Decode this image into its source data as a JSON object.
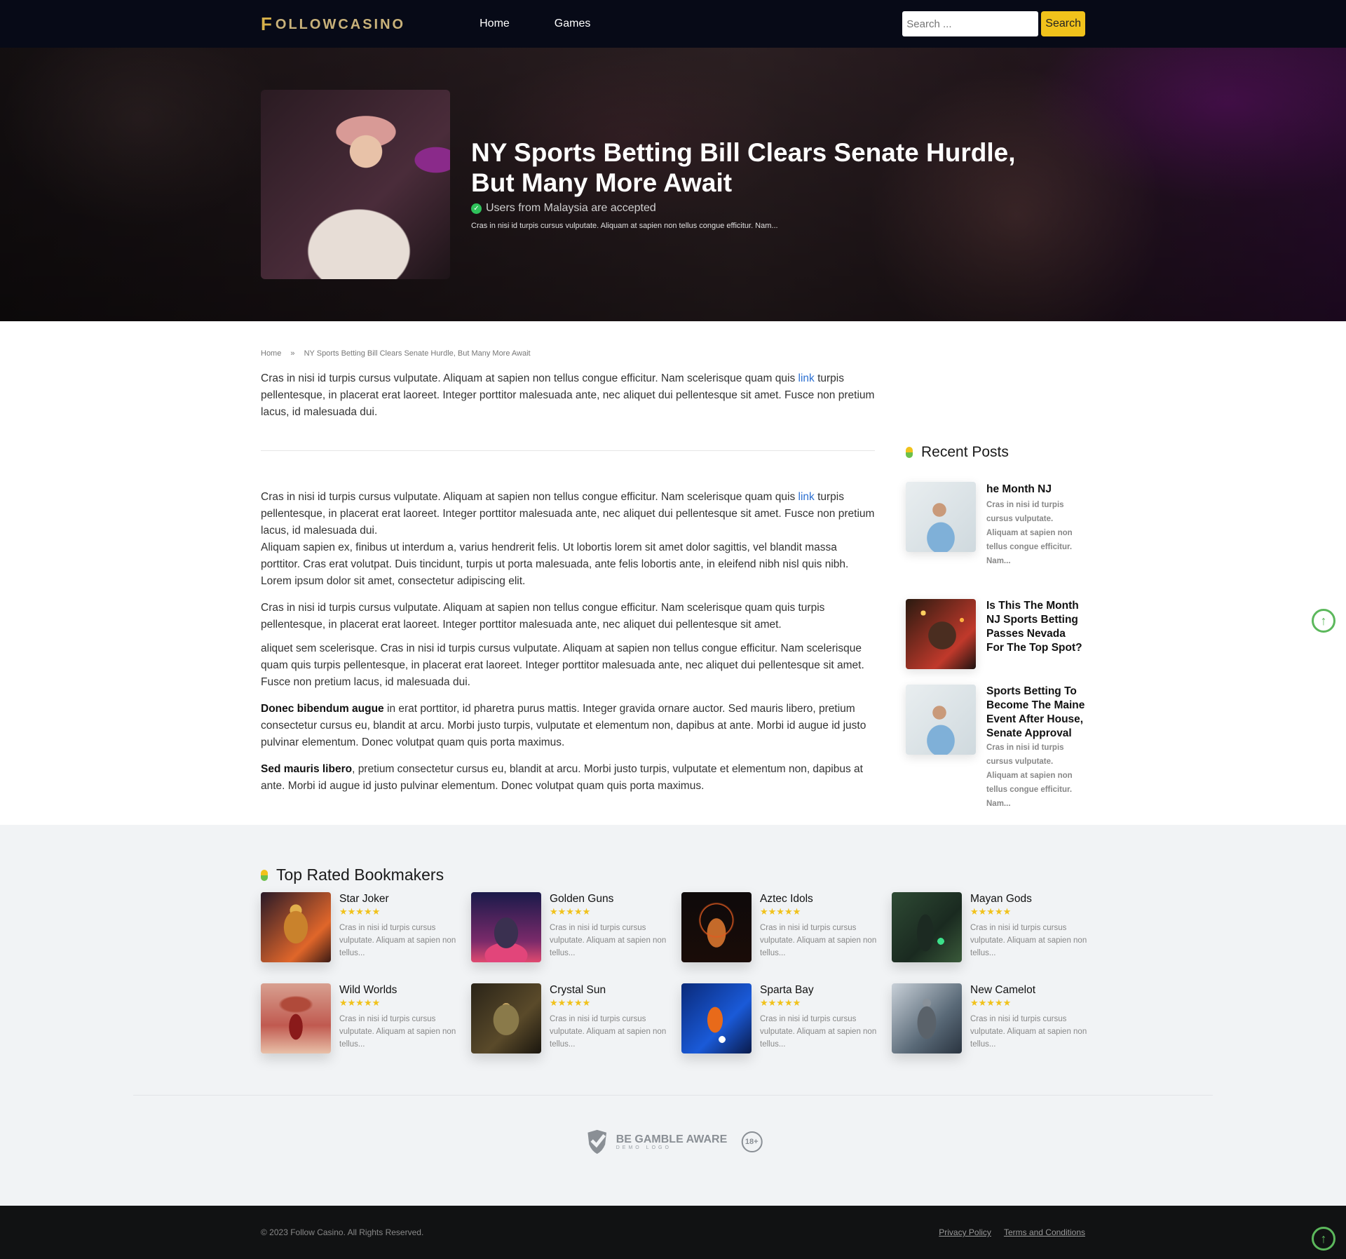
{
  "header": {
    "logo_initial": "F",
    "logo_text": "OLLOWCASINO",
    "nav": [
      "Home",
      "Games"
    ],
    "search_placeholder": "Search ...",
    "search_button": "Search"
  },
  "hero": {
    "title": "NY Sports Betting Bill Clears Senate Hurdle, But Many More Await",
    "accepted": "Users from Malaysia are accepted",
    "excerpt": "Cras in nisi id turpis cursus vulputate. Aliquam at sapien non tellus congue efficitur. Nam..."
  },
  "breadcrumb": {
    "home": "Home",
    "separator": "»",
    "current": "NY Sports Betting Bill Clears Senate Hurdle, But Many More Await"
  },
  "article": {
    "intro_before_link": "Cras in nisi id turpis cursus vulputate. Aliquam at sapien non tellus congue efficitur. Nam scelerisque quam quis ",
    "link_text": "link",
    "intro_after_link": " turpis pellentesque, in placerat erat laoreet. Integer porttitor malesuada ante, nec aliquet dui pellentesque sit amet. Fusce non pretium lacus, id malesuada dui.",
    "p1_before_link": "Cras in nisi id turpis cursus vulputate. Aliquam at sapien non tellus congue efficitur. Nam scelerisque quam quis ",
    "p1_after_link": " turpis pellentesque, in placerat erat laoreet. Integer porttitor malesuada ante, nec aliquet dui pellentesque sit amet. Fusce non pretium lacus, id malesuada dui.",
    "p1_line2": "Aliquam sapien ex, finibus ut interdum a, varius hendrerit felis. Ut lobortis lorem sit amet dolor sagittis, vel blandit massa porttitor. Cras erat volutpat. Duis tincidunt, turpis ut porta malesuada, ante felis lobortis ante, in eleifend nibh nisl quis nibh. Lorem ipsum dolor sit amet, consectetur adipiscing elit.",
    "p2": "Cras in nisi id turpis cursus vulputate. Aliquam at sapien non tellus congue efficitur. Nam scelerisque quam quis turpis pellentesque, in placerat erat laoreet. Integer porttitor malesuada ante, nec aliquet dui pellentesque sit amet.",
    "p3": "aliquet sem scelerisque. Cras in nisi id turpis cursus vulputate. Aliquam at sapien non tellus congue efficitur. Nam scelerisque quam quis turpis pellentesque, in placerat erat laoreet. Integer porttitor malesuada ante, nec aliquet dui pellentesque sit amet. Fusce non pretium lacus, id malesuada dui.",
    "p4_bold": "Donec bibendum augue",
    "p4_rest": " in erat porttitor, id pharetra purus mattis. Integer gravida ornare auctor. Sed mauris libero, pretium consectetur cursus eu, blandit at arcu. Morbi justo turpis, vulputate et elementum non, dapibus at ante. Morbi id augue id justo pulvinar elementum. Donec volutpat quam quis porta maximus.",
    "p5_bold": "Sed mauris libero",
    "p5_rest": ", pretium consectetur cursus eu, blandit at arcu. Morbi justo turpis, vulputate et elementum non, dapibus at ante. Morbi id augue id justo pulvinar elementum. Donec volutpat quam quis porta maximus."
  },
  "sidebar": {
    "title": "Recent Posts",
    "posts": [
      {
        "title": "he Month NJ",
        "desc": "Cras in nisi id turpis cursus vulputate. Aliquam at sapien non tellus congue efficitur. Nam..."
      },
      {
        "title": "Is This The Month NJ Sports Betting Passes Nevada For The Top Spot?",
        "desc": ""
      },
      {
        "title": "Sports Betting To Become The Maine Event After House, Senate Approval",
        "desc": "Cras in nisi id turpis cursus vulputate. Aliquam at sapien non tellus congue efficitur. Nam..."
      }
    ]
  },
  "bookmakers": {
    "title": "Top Rated Bookmakers",
    "stars": "★★★★★",
    "desc": "Cras in nisi id turpis cursus vulputate. Aliquam at sapien non tellus...",
    "items": [
      {
        "name": "Star Joker",
        "rating": 5
      },
      {
        "name": "Golden Guns",
        "rating": 5
      },
      {
        "name": "Aztec Idols",
        "rating": 5
      },
      {
        "name": "Mayan Gods",
        "rating": 5
      },
      {
        "name": "Wild Worlds",
        "rating": 5
      },
      {
        "name": "Crystal Sun",
        "rating": 5
      },
      {
        "name": "Sparta Bay",
        "rating": 5
      },
      {
        "name": "New Camelot",
        "rating": 5
      }
    ]
  },
  "gamble": {
    "title": "BE GAMBLE AWARE",
    "sub": "DEMO LOGO",
    "age": "18+"
  },
  "footer": {
    "copyright": "© 2023 Follow Casino. All Rights Reserved.",
    "privacy": "Privacy Policy",
    "terms": "Terms and Conditions"
  },
  "colors": {
    "accent_yellow": "#f1c21b",
    "accent_green": "#5cb85c",
    "header_bg": "#070a17",
    "link_blue": "#2b6fd1"
  }
}
